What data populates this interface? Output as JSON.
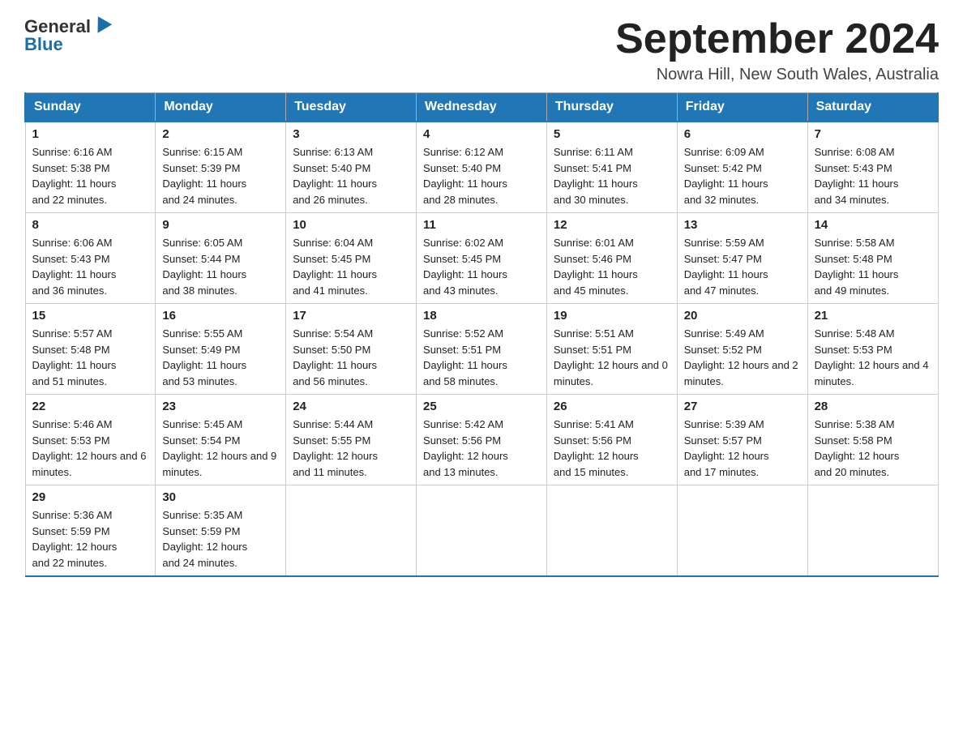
{
  "logo": {
    "general": "General",
    "blue": "Blue"
  },
  "title": "September 2024",
  "location": "Nowra Hill, New South Wales, Australia",
  "days_of_week": [
    "Sunday",
    "Monday",
    "Tuesday",
    "Wednesday",
    "Thursday",
    "Friday",
    "Saturday"
  ],
  "weeks": [
    [
      {
        "day": "1",
        "sunrise": "6:16 AM",
        "sunset": "5:38 PM",
        "daylight": "11 hours and 22 minutes."
      },
      {
        "day": "2",
        "sunrise": "6:15 AM",
        "sunset": "5:39 PM",
        "daylight": "11 hours and 24 minutes."
      },
      {
        "day": "3",
        "sunrise": "6:13 AM",
        "sunset": "5:40 PM",
        "daylight": "11 hours and 26 minutes."
      },
      {
        "day": "4",
        "sunrise": "6:12 AM",
        "sunset": "5:40 PM",
        "daylight": "11 hours and 28 minutes."
      },
      {
        "day": "5",
        "sunrise": "6:11 AM",
        "sunset": "5:41 PM",
        "daylight": "11 hours and 30 minutes."
      },
      {
        "day": "6",
        "sunrise": "6:09 AM",
        "sunset": "5:42 PM",
        "daylight": "11 hours and 32 minutes."
      },
      {
        "day": "7",
        "sunrise": "6:08 AM",
        "sunset": "5:43 PM",
        "daylight": "11 hours and 34 minutes."
      }
    ],
    [
      {
        "day": "8",
        "sunrise": "6:06 AM",
        "sunset": "5:43 PM",
        "daylight": "11 hours and 36 minutes."
      },
      {
        "day": "9",
        "sunrise": "6:05 AM",
        "sunset": "5:44 PM",
        "daylight": "11 hours and 38 minutes."
      },
      {
        "day": "10",
        "sunrise": "6:04 AM",
        "sunset": "5:45 PM",
        "daylight": "11 hours and 41 minutes."
      },
      {
        "day": "11",
        "sunrise": "6:02 AM",
        "sunset": "5:45 PM",
        "daylight": "11 hours and 43 minutes."
      },
      {
        "day": "12",
        "sunrise": "6:01 AM",
        "sunset": "5:46 PM",
        "daylight": "11 hours and 45 minutes."
      },
      {
        "day": "13",
        "sunrise": "5:59 AM",
        "sunset": "5:47 PM",
        "daylight": "11 hours and 47 minutes."
      },
      {
        "day": "14",
        "sunrise": "5:58 AM",
        "sunset": "5:48 PM",
        "daylight": "11 hours and 49 minutes."
      }
    ],
    [
      {
        "day": "15",
        "sunrise": "5:57 AM",
        "sunset": "5:48 PM",
        "daylight": "11 hours and 51 minutes."
      },
      {
        "day": "16",
        "sunrise": "5:55 AM",
        "sunset": "5:49 PM",
        "daylight": "11 hours and 53 minutes."
      },
      {
        "day": "17",
        "sunrise": "5:54 AM",
        "sunset": "5:50 PM",
        "daylight": "11 hours and 56 minutes."
      },
      {
        "day": "18",
        "sunrise": "5:52 AM",
        "sunset": "5:51 PM",
        "daylight": "11 hours and 58 minutes."
      },
      {
        "day": "19",
        "sunrise": "5:51 AM",
        "sunset": "5:51 PM",
        "daylight": "12 hours and 0 minutes."
      },
      {
        "day": "20",
        "sunrise": "5:49 AM",
        "sunset": "5:52 PM",
        "daylight": "12 hours and 2 minutes."
      },
      {
        "day": "21",
        "sunrise": "5:48 AM",
        "sunset": "5:53 PM",
        "daylight": "12 hours and 4 minutes."
      }
    ],
    [
      {
        "day": "22",
        "sunrise": "5:46 AM",
        "sunset": "5:53 PM",
        "daylight": "12 hours and 6 minutes."
      },
      {
        "day": "23",
        "sunrise": "5:45 AM",
        "sunset": "5:54 PM",
        "daylight": "12 hours and 9 minutes."
      },
      {
        "day": "24",
        "sunrise": "5:44 AM",
        "sunset": "5:55 PM",
        "daylight": "12 hours and 11 minutes."
      },
      {
        "day": "25",
        "sunrise": "5:42 AM",
        "sunset": "5:56 PM",
        "daylight": "12 hours and 13 minutes."
      },
      {
        "day": "26",
        "sunrise": "5:41 AM",
        "sunset": "5:56 PM",
        "daylight": "12 hours and 15 minutes."
      },
      {
        "day": "27",
        "sunrise": "5:39 AM",
        "sunset": "5:57 PM",
        "daylight": "12 hours and 17 minutes."
      },
      {
        "day": "28",
        "sunrise": "5:38 AM",
        "sunset": "5:58 PM",
        "daylight": "12 hours and 20 minutes."
      }
    ],
    [
      {
        "day": "29",
        "sunrise": "5:36 AM",
        "sunset": "5:59 PM",
        "daylight": "12 hours and 22 minutes."
      },
      {
        "day": "30",
        "sunrise": "5:35 AM",
        "sunset": "5:59 PM",
        "daylight": "12 hours and 24 minutes."
      },
      null,
      null,
      null,
      null,
      null
    ]
  ],
  "labels": {
    "sunrise": "Sunrise:",
    "sunset": "Sunset:",
    "daylight": "Daylight:"
  }
}
